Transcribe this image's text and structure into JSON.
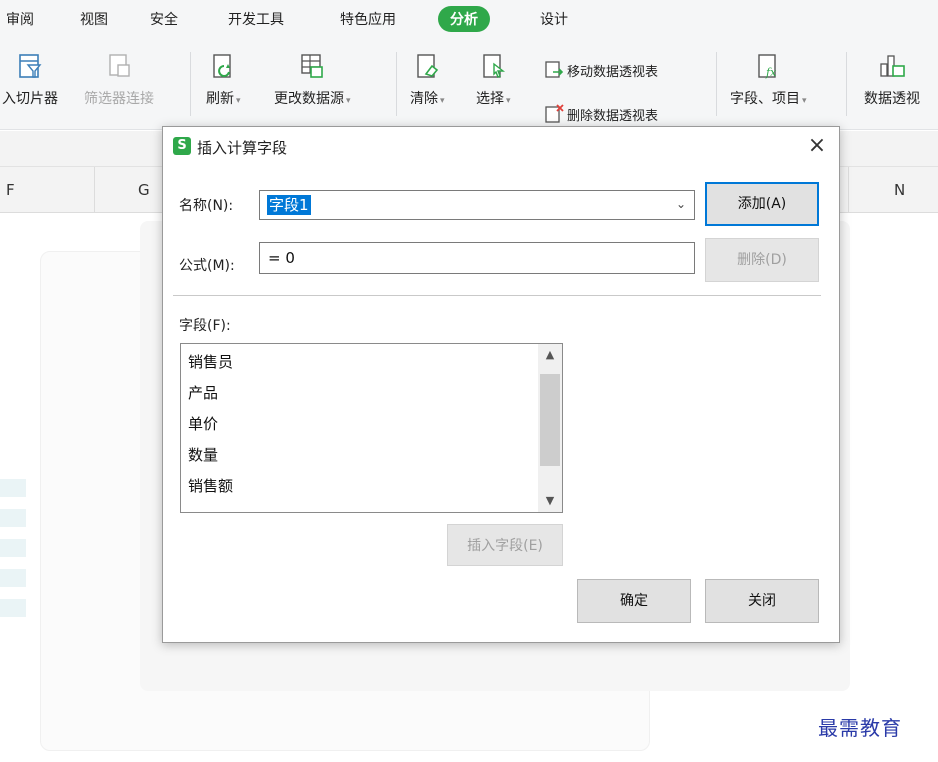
{
  "ribbon": {
    "tabs": [
      {
        "label": "审阅"
      },
      {
        "label": "视图"
      },
      {
        "label": "安全"
      },
      {
        "label": "开发工具"
      },
      {
        "label": "特色应用"
      },
      {
        "label": "分析",
        "active": true
      },
      {
        "label": "设计"
      }
    ],
    "tools": {
      "slicer": "入切片器",
      "filter_connect": "筛选器连接",
      "refresh": "刷新",
      "change_source": "更改数据源",
      "clear": "清除",
      "select": "选择",
      "move_pivot": "移动数据透视表",
      "delete_pivot": "删除数据透视表",
      "fields_items": "字段、项目",
      "pivot_chart": "数据透视"
    },
    "caret": "▾",
    "accent_color": "#2fa84a"
  },
  "sheet": {
    "columns": [
      "F",
      "G",
      "N"
    ]
  },
  "dialog": {
    "logo": "S",
    "title": "插入计算字段",
    "close_glyph": "×",
    "name_label": "名称(N):",
    "name_value": "字段1",
    "name_chevron": "⌄",
    "formula_label": "公式(M):",
    "formula_value": "= 0",
    "add_button": "添加(A)",
    "delete_button": "删除(D)",
    "fields_label": "字段(F):",
    "fields": [
      "销售员",
      "产品",
      "单价",
      "数量",
      "销售额"
    ],
    "scroll_up": "▲",
    "scroll_down": "▼",
    "insert_field_button": "插入字段(E)",
    "ok_button": "确定",
    "close_button": "关闭"
  },
  "watermark": "最需教育"
}
